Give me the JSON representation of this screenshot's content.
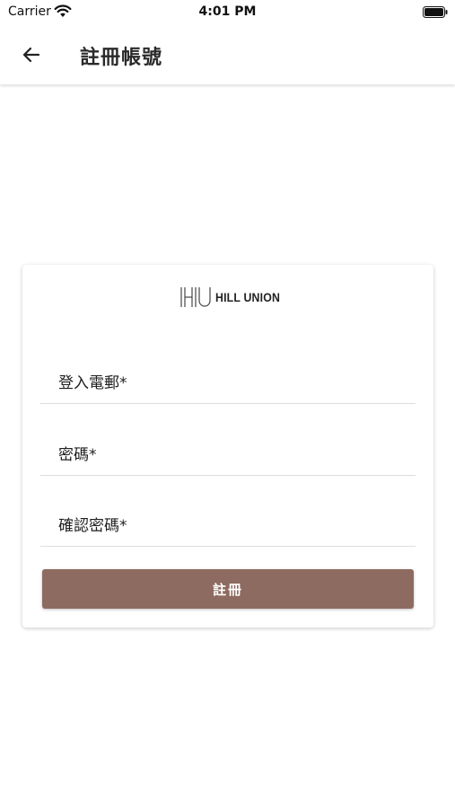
{
  "status_bar": {
    "carrier": "Carrier",
    "time": "4:01 PM"
  },
  "app_bar": {
    "title": "註冊帳號",
    "back_icon": "arrow-left-icon"
  },
  "card": {
    "logo": {
      "mark": "HU",
      "text": "HILL UNION"
    },
    "fields": [
      {
        "label": "登入電郵*"
      },
      {
        "label": "密碼*"
      },
      {
        "label": "確認密碼*"
      }
    ],
    "submit_label": "註冊"
  },
  "colors": {
    "primary_button": "#8e6b60",
    "divider": "#dedede"
  }
}
